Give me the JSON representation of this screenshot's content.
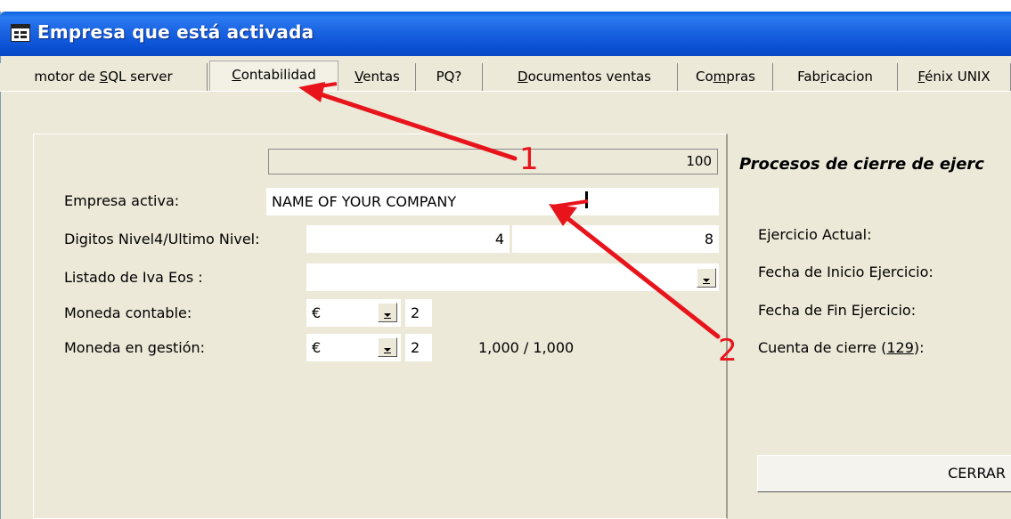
{
  "window": {
    "title": "Empresa que está activada"
  },
  "tabs": [
    {
      "label": "motor de SQL server",
      "access_key": "S"
    },
    {
      "label": "Contabilidad",
      "access_key": "C"
    },
    {
      "label": "Ventas",
      "access_key": "V"
    },
    {
      "label": "PQ?"
    },
    {
      "label": "Documentos ventas",
      "access_key": "D"
    },
    {
      "label": "Compras",
      "access_key": "m"
    },
    {
      "label": "Fabricacion",
      "access_key": "r"
    },
    {
      "label": "Fénix UNIX",
      "access_key": "F"
    }
  ],
  "active_tab": "Contabilidad",
  "form": {
    "progress_value": "100",
    "empresa_label": "Empresa activa:",
    "empresa_value": "NAME OF YOUR COMPANY",
    "digitos_label": "Digitos Nivel4/Ultimo Nivel:",
    "digitos_nivel4": "4",
    "digitos_ultimo": "8",
    "listado_label": "Listado de Iva Eos :",
    "listado_value": "",
    "moneda_contable_label": "Moneda contable:",
    "moneda_contable_symbol": "€",
    "moneda_contable_decimals": "2",
    "moneda_gestion_label": "Moneda en gestión:",
    "moneda_gestion_symbol": "€",
    "moneda_gestion_decimals": "2",
    "exchange_rate": "1,000 / 1,000"
  },
  "closing": {
    "title": "Procesos de cierre de ejerc",
    "ejercicio_actual_label": "Ejercicio Actual:",
    "fecha_inicio_label": "Fecha de Inicio Ejercicio:",
    "fecha_fin_label": "Fecha de Fin Ejercicio:",
    "cuenta_cierre_label_prefix": "Cuenta de cierre (",
    "cuenta_cierre_code": "129",
    "cuenta_cierre_label_suffix": "):",
    "cerrar_button": "CERRAR"
  },
  "annotations": [
    {
      "number": "1",
      "color": "#e8141c"
    },
    {
      "number": "2",
      "color": "#e8141c"
    }
  ],
  "colors": {
    "titlebar": "#0a50d4",
    "face": "#ECE9D8",
    "arrow": "#e8141c"
  }
}
